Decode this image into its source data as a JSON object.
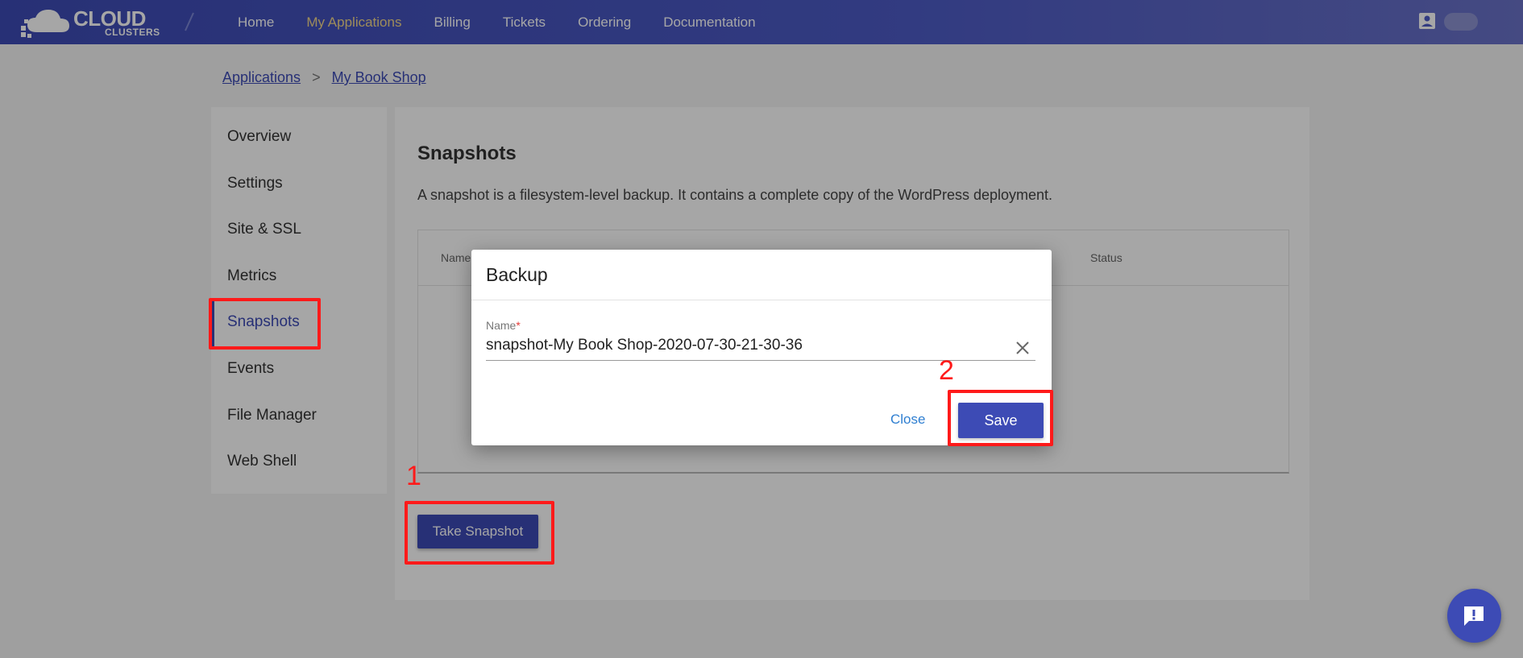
{
  "header": {
    "logo_text": "CLOUD",
    "logo_sub": "CLUSTERS",
    "nav": [
      {
        "label": "Home",
        "active": false
      },
      {
        "label": "My Applications",
        "active": true
      },
      {
        "label": "Billing",
        "active": false
      },
      {
        "label": "Tickets",
        "active": false
      },
      {
        "label": "Ordering",
        "active": false
      },
      {
        "label": "Documentation",
        "active": false
      }
    ],
    "user_icon": "account-box-icon"
  },
  "breadcrumb": {
    "items": [
      "Applications",
      "My Book Shop"
    ],
    "separator": ">"
  },
  "sidebar": {
    "items": [
      {
        "label": "Overview"
      },
      {
        "label": "Settings"
      },
      {
        "label": "Site & SSL"
      },
      {
        "label": "Metrics"
      },
      {
        "label": "Snapshots",
        "active": true
      },
      {
        "label": "Events"
      },
      {
        "label": "File Manager"
      },
      {
        "label": "Web Shell"
      }
    ]
  },
  "main": {
    "title": "Snapshots",
    "description": "A snapshot is a filesystem-level backup. It contains a complete copy of the WordPress deployment.",
    "table": {
      "columns": [
        "Name",
        "Status"
      ]
    },
    "take_snapshot_label": "Take Snapshot"
  },
  "modal": {
    "title": "Backup",
    "name_label": "Name",
    "required_mark": "*",
    "name_value": "snapshot-My Book Shop-2020-07-30-21-30-36",
    "close_label": "Close",
    "save_label": "Save"
  },
  "annotations": {
    "step1": "1",
    "step2": "2",
    "color": "#ff1a1a"
  },
  "colors": {
    "accent": "#3d4bb5",
    "active_nav": "#f3d78a",
    "link": "#2f7fd1"
  },
  "chat": {
    "icon": "chat-alert-icon"
  }
}
